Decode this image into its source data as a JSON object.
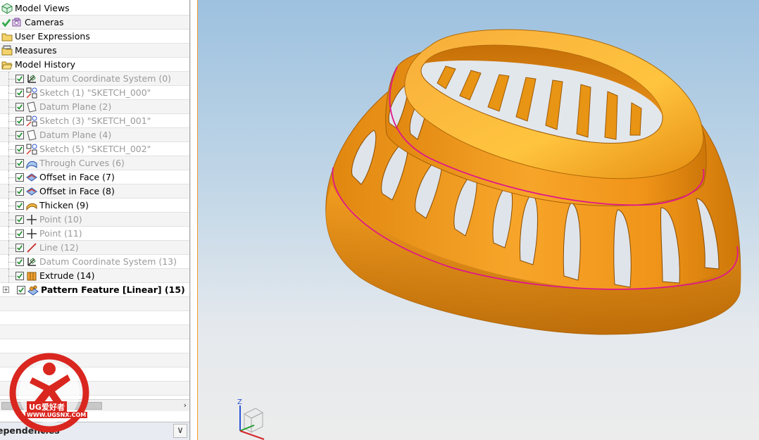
{
  "navigator": {
    "rows": [
      {
        "label": "Model Views",
        "icon": "model-views-icon",
        "dim": false,
        "bold": false,
        "checked": false,
        "level": 0
      },
      {
        "label": "Cameras",
        "icon": "cameras-icon",
        "dim": false,
        "bold": false,
        "checked": true,
        "level": 0
      },
      {
        "label": "User Expressions",
        "icon": "folder-icon",
        "dim": false,
        "bold": false,
        "checked": false,
        "level": 0
      },
      {
        "label": "Measures",
        "icon": "measures-icon",
        "dim": false,
        "bold": false,
        "checked": false,
        "level": 0
      },
      {
        "label": "Model History",
        "icon": "open-folder-icon",
        "dim": false,
        "bold": false,
        "checked": false,
        "level": 0
      },
      {
        "label": "Datum Coordinate System (0)",
        "icon": "datum-csys-icon",
        "dim": true,
        "bold": false,
        "checked": true,
        "level": 1
      },
      {
        "label": "Sketch (1) \"SKETCH_000\"",
        "icon": "sketch-icon",
        "dim": true,
        "bold": false,
        "checked": true,
        "level": 1
      },
      {
        "label": "Datum Plane (2)",
        "icon": "datum-plane-icon",
        "dim": true,
        "bold": false,
        "checked": true,
        "level": 1
      },
      {
        "label": "Sketch (3) \"SKETCH_001\"",
        "icon": "sketch-icon",
        "dim": true,
        "bold": false,
        "checked": true,
        "level": 1
      },
      {
        "label": "Datum Plane (4)",
        "icon": "datum-plane-icon",
        "dim": true,
        "bold": false,
        "checked": true,
        "level": 1
      },
      {
        "label": "Sketch (5) \"SKETCH_002\"",
        "icon": "sketch-icon",
        "dim": true,
        "bold": false,
        "checked": true,
        "level": 1
      },
      {
        "label": "Through Curves (6)",
        "icon": "through-curves-icon",
        "dim": true,
        "bold": false,
        "checked": true,
        "level": 1
      },
      {
        "label": "Offset in Face (7)",
        "icon": "offset-in-face-icon",
        "dim": false,
        "bold": false,
        "checked": true,
        "level": 1
      },
      {
        "label": "Offset in Face (8)",
        "icon": "offset-in-face-icon",
        "dim": false,
        "bold": false,
        "checked": true,
        "level": 1
      },
      {
        "label": "Thicken (9)",
        "icon": "thicken-icon",
        "dim": false,
        "bold": false,
        "checked": true,
        "level": 1
      },
      {
        "label": "Point (10)",
        "icon": "point-icon",
        "dim": true,
        "bold": false,
        "checked": true,
        "level": 1
      },
      {
        "label": "Point (11)",
        "icon": "point-icon",
        "dim": true,
        "bold": false,
        "checked": true,
        "level": 1
      },
      {
        "label": "Line (12)",
        "icon": "line-icon",
        "dim": true,
        "bold": false,
        "checked": true,
        "level": 1
      },
      {
        "label": "Datum Coordinate System (13)",
        "icon": "datum-csys-icon",
        "dim": true,
        "bold": false,
        "checked": true,
        "level": 1
      },
      {
        "label": "Extrude (14)",
        "icon": "extrude-icon",
        "dim": false,
        "bold": false,
        "checked": true,
        "level": 1
      },
      {
        "label": "Pattern Feature [Linear] (15)",
        "icon": "pattern-feature-icon",
        "dim": false,
        "bold": true,
        "checked": true,
        "level": 1,
        "expandable": true
      }
    ]
  },
  "dependencies_panel": {
    "title": "ependencies"
  },
  "watermark": {
    "text": "UG爱好者",
    "url": "WWW.UGSNX.COM"
  },
  "triad": {
    "z_label": "Z"
  },
  "colors": {
    "model_orange": "#f39a1e",
    "edge_magenta": "#e0168a",
    "background_top": "#9dc1df",
    "background_bottom": "#ececec"
  }
}
